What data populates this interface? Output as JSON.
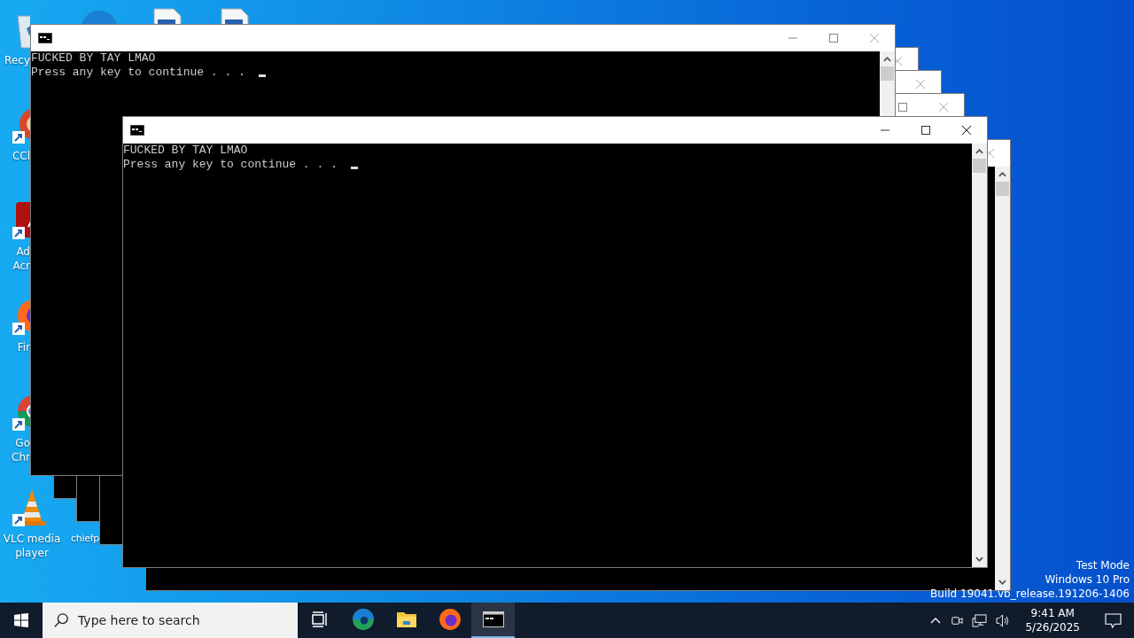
{
  "desktop_icons": [
    {
      "kind": "recycle-bin",
      "label_lines": [
        "Recy"
      ]
    },
    {
      "kind": "ccleaner",
      "label_lines": [
        "CCl"
      ]
    },
    {
      "kind": "acrobat",
      "label_lines": [
        "Ad",
        "Acr"
      ]
    },
    {
      "kind": "firefox",
      "label_lines": [
        "Fir"
      ]
    },
    {
      "kind": "chrome",
      "label_lines": [
        "Go",
        "Chr"
      ]
    },
    {
      "kind": "vlc",
      "label_lines": [
        "VLC media",
        "player"
      ]
    },
    {
      "kind": "edge"
    },
    {
      "kind": "document"
    },
    {
      "kind": "document"
    },
    {
      "kind": "file",
      "label_lines": [
        "chiefp"
      ]
    }
  ],
  "windows": [
    {
      "active": false,
      "controls": [
        {
          "kind": "minimize"
        },
        {
          "kind": "maximize"
        },
        {
          "kind": "close"
        }
      ],
      "lines": [
        "FUCKED BY TAY LMAO",
        "Press any key to continue . . ."
      ]
    },
    {
      "active": false,
      "controls": [
        {
          "kind": "close"
        }
      ]
    },
    {
      "active": false,
      "controls": [
        {
          "kind": "close"
        }
      ]
    },
    {
      "active": false,
      "controls": [
        {
          "kind": "maximize"
        },
        {
          "kind": "close"
        }
      ]
    },
    {
      "active": true,
      "controls": [
        {
          "kind": "minimize"
        },
        {
          "kind": "maximize"
        },
        {
          "kind": "close"
        }
      ],
      "lines": [
        "FUCKED BY TAY LMAO",
        "Press any key to continue . . ."
      ]
    },
    {
      "active": false,
      "controls": [
        {
          "kind": "close"
        }
      ]
    }
  ],
  "os_notice": [
    "Test Mode",
    "Windows 10 Pro",
    "Build 19041.vb_release.191206-1406"
  ],
  "taskbar": {
    "search": {
      "placeholder": "Type here to search"
    },
    "apps": [
      {
        "kind": "task-view",
        "selected": false
      },
      {
        "kind": "edge",
        "selected": false
      },
      {
        "kind": "explorer",
        "selected": false
      },
      {
        "kind": "firefox",
        "selected": false
      },
      {
        "kind": "console",
        "selected": true
      }
    ],
    "clock": {
      "time": "9:41 AM",
      "date": "5/26/2025"
    }
  }
}
